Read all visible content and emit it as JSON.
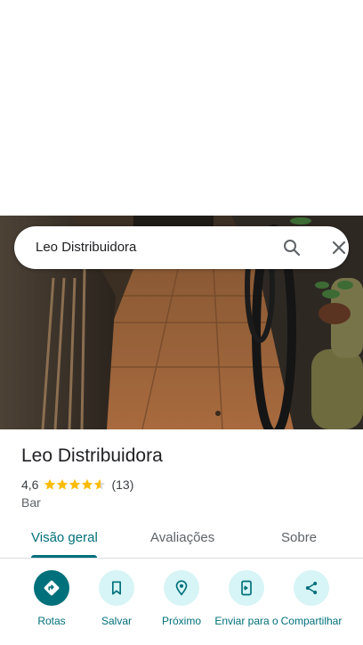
{
  "search": {
    "query": "Leo Distribuidora"
  },
  "place": {
    "name": "Leo Distribuidora",
    "rating": "4,6",
    "stars": 4.6,
    "review_count": "(13)",
    "category": "Bar"
  },
  "tabs": [
    {
      "label": "Visão geral",
      "active": true
    },
    {
      "label": "Avaliações",
      "active": false
    },
    {
      "label": "Sobre",
      "active": false
    }
  ],
  "actions": [
    {
      "label": "Rotas",
      "icon": "directions-icon"
    },
    {
      "label": "Salvar",
      "icon": "bookmark-icon"
    },
    {
      "label": "Próximo",
      "icon": "nearby-icon"
    },
    {
      "label": "Enviar para o",
      "icon": "send-to-phone-icon"
    },
    {
      "label": "Compartilhar",
      "icon": "share-icon"
    }
  ],
  "colors": {
    "accent": "#00707a",
    "action_bg": "#d7f4f6",
    "star": "#fbbc04"
  }
}
